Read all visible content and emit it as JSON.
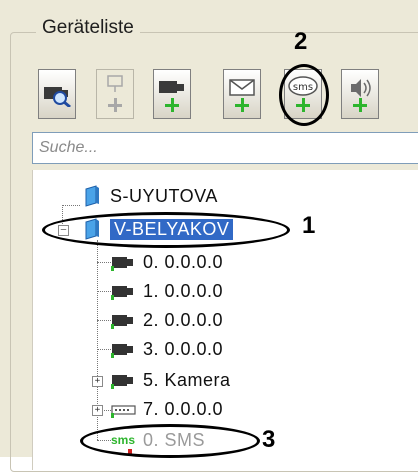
{
  "group": {
    "title": "Geräteliste"
  },
  "toolbar": {
    "buttons": [
      {
        "icon": "camera-search-icon",
        "enabled": true,
        "plus": false
      },
      {
        "icon": "network-add-icon",
        "enabled": false,
        "plus": true
      },
      {
        "icon": "camera-add-icon",
        "enabled": true,
        "plus": true
      },
      {
        "icon": "mail-add-icon",
        "enabled": true,
        "plus": true
      },
      {
        "icon": "sms-add-icon",
        "enabled": true,
        "plus": true,
        "label": "sms"
      },
      {
        "icon": "speaker-add-icon",
        "enabled": true,
        "plus": true
      }
    ]
  },
  "search": {
    "placeholder": "Suche..."
  },
  "tree": {
    "computers": [
      {
        "label": "S-UYUTOVA"
      },
      {
        "label": "V-BELYAKOV",
        "selected": true,
        "expanded": true
      }
    ],
    "devices": [
      {
        "label": "0. 0.0.0.0",
        "icon": "camera-icon"
      },
      {
        "label": "1. 0.0.0.0",
        "icon": "camera-icon"
      },
      {
        "label": "2. 0.0.0.0",
        "icon": "camera-icon"
      },
      {
        "label": "3. 0.0.0.0",
        "icon": "camera-icon"
      },
      {
        "label": "5. Kamera",
        "icon": "camera-icon",
        "expandable": true
      },
      {
        "label": "7. 0.0.0.0",
        "icon": "io-board-icon",
        "expandable": true
      },
      {
        "label": "0. SMS",
        "icon": "sms-icon",
        "icon_text": "sms"
      }
    ]
  },
  "annotations": {
    "n1": "1",
    "n2": "2",
    "n3": "3"
  },
  "colors": {
    "selection": "#3169c6",
    "plus": "#2db52d",
    "annotation": "#000000"
  }
}
